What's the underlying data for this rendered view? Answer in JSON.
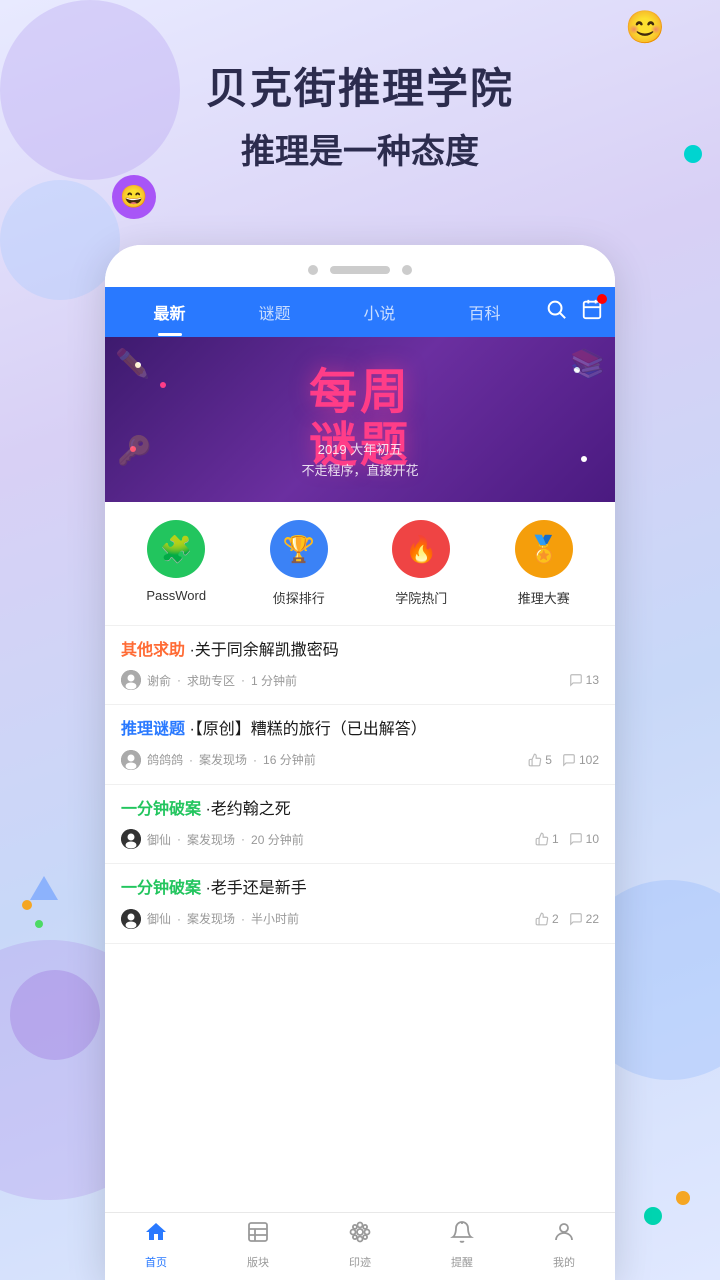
{
  "app": {
    "title": "贝克街推理学院",
    "subtitle": "推理是一种态度"
  },
  "nav": {
    "tabs": [
      {
        "label": "最新",
        "active": true
      },
      {
        "label": "谜题",
        "active": false
      },
      {
        "label": "小说",
        "active": false
      },
      {
        "label": "百科",
        "active": false
      }
    ]
  },
  "banner": {
    "main_text": "每周\n谜题",
    "sub_line1": "2019 大年初五",
    "sub_line2": "不走程序，直接开花"
  },
  "quick_icons": [
    {
      "label": "PassWord",
      "color": "green",
      "emoji": "🧩"
    },
    {
      "label": "侦探排行",
      "color": "blue",
      "emoji": "🏆"
    },
    {
      "label": "学院热门",
      "color": "red",
      "emoji": "🔥"
    },
    {
      "label": "推理大赛",
      "color": "orange",
      "emoji": "🏅"
    }
  ],
  "feed": [
    {
      "category": "其他求助",
      "category_color": "orange",
      "title": "关于同余解凯撒密码",
      "author": "谢俞",
      "section": "求助专区",
      "time": "1 分钟前",
      "likes": null,
      "comments": 13
    },
    {
      "category": "推理谜题",
      "category_color": "blue",
      "title": "【原创】糟糕的旅行（已出解答）",
      "author": "鸽鸽鸽",
      "section": "案发现场",
      "time": "16 分钟前",
      "likes": 5,
      "comments": 102
    },
    {
      "category": "一分钟破案",
      "category_color": "green",
      "title": "老约翰之死",
      "author": "御仙",
      "section": "案发现场",
      "time": "20 分钟前",
      "likes": 1,
      "comments": 10
    },
    {
      "category": "一分钟破案",
      "category_color": "green",
      "title": "老手还是新手",
      "author": "御仙",
      "section": "案发现场",
      "time": "半小时前",
      "likes": 2,
      "comments": 22
    }
  ],
  "bottom_nav": [
    {
      "label": "首页",
      "active": true,
      "icon": "home"
    },
    {
      "label": "版块",
      "active": false,
      "icon": "grid"
    },
    {
      "label": "印迹",
      "active": false,
      "icon": "flower"
    },
    {
      "label": "提醒",
      "active": false,
      "icon": "bell"
    },
    {
      "label": "我的",
      "active": false,
      "icon": "person"
    }
  ]
}
